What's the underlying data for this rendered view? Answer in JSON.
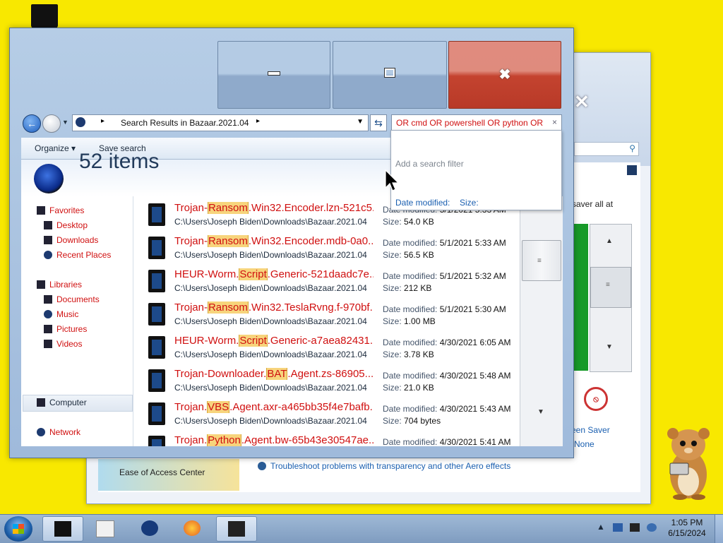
{
  "background_window": {
    "saver_text": "saver all at",
    "screen_saver_label": "een Saver",
    "screen_saver_value": "None",
    "ease_of_access": "Ease of Access Center",
    "troubleshoot_link": "Troubleshoot problems with transparency and other Aero effects"
  },
  "explorer": {
    "caption_close_glyph": "✖",
    "address_crumb": "Search Results in Bazaar.2021.04",
    "search_query": "OR cmd OR powershell OR python OR j",
    "search_clear": "×",
    "toolbar": {
      "organize_label": "Organize ▾",
      "save_search_label": "Save search"
    },
    "library_header": {
      "count": "52 items"
    },
    "nav": {
      "favorites": "Favorites",
      "desktop": "Desktop",
      "downloads": "Downloads",
      "recent_places": "Recent Places",
      "libraries": "Libraries",
      "documents": "Documents",
      "music": "Music",
      "pictures": "Pictures",
      "videos": "Videos",
      "computer": "Computer",
      "network": "Network"
    },
    "date_prefix": "Date modified:",
    "size_prefix": "Size:",
    "files": [
      {
        "pre": "Trojan-",
        "hl": "Ransom",
        "post": ".Win32.Encoder.lzn-521c5...",
        "path": "C:\\Users\\Joseph Biden\\Downloads\\Bazaar.2021.04",
        "date": "5/1/2021 5:33 AM",
        "size": "54.0 KB"
      },
      {
        "pre": "Trojan-",
        "hl": "Ransom",
        "post": ".Win32.Encoder.mdb-0a0...",
        "path": "C:\\Users\\Joseph Biden\\Downloads\\Bazaar.2021.04",
        "date": "5/1/2021 5:33 AM",
        "size": "56.5 KB"
      },
      {
        "pre": "HEUR-Worm.",
        "hl": "Script",
        "post": ".Generic-521daadc7e...",
        "path": "C:\\Users\\Joseph Biden\\Downloads\\Bazaar.2021.04",
        "date": "5/1/2021 5:32 AM",
        "size": "212 KB"
      },
      {
        "pre": "Trojan-",
        "hl": "Ransom",
        "post": ".Win32.TeslaRvng.f-970bf...",
        "path": "C:\\Users\\Joseph Biden\\Downloads\\Bazaar.2021.04",
        "date": "5/1/2021 5:30 AM",
        "size": "1.00 MB"
      },
      {
        "pre": "HEUR-Worm.",
        "hl": "Script",
        "post": ".Generic-a7aea82431...",
        "path": "C:\\Users\\Joseph Biden\\Downloads\\Bazaar.2021.04",
        "date": "4/30/2021 6:05 AM",
        "size": "3.78 KB"
      },
      {
        "pre": "Trojan-Downloader.",
        "hl": "BAT",
        "post": ".Agent.zs-86905...",
        "path": "C:\\Users\\Joseph Biden\\Downloads\\Bazaar.2021.04",
        "date": "4/30/2021 5:48 AM",
        "size": "21.0 KB"
      },
      {
        "pre": "Trojan.",
        "hl": "VBS",
        "post": ".Agent.axr-a465bb35f4e7bafb...",
        "path": "C:\\Users\\Joseph Biden\\Downloads\\Bazaar.2021.04",
        "date": "4/30/2021 5:43 AM",
        "size": "704 bytes"
      },
      {
        "pre": "Trojan.",
        "hl": "Python",
        "post": ".Agent.bw-65b43e30547ae...",
        "path": "",
        "date": "4/30/2021 5:41 AM",
        "size": ""
      }
    ],
    "search_filter": {
      "hint": "Add a search filter",
      "filter_date": "Date modified:",
      "filter_size": "Size:"
    }
  },
  "taskbar": {
    "clock_time": "1:05 PM",
    "clock_date": "6/15/2024",
    "tray_arrow": "▲"
  },
  "colors": {
    "desktop": "#f8e800",
    "match_text": "#d01010",
    "highlight": "#f7d47c",
    "link": "#1a5fb0"
  }
}
